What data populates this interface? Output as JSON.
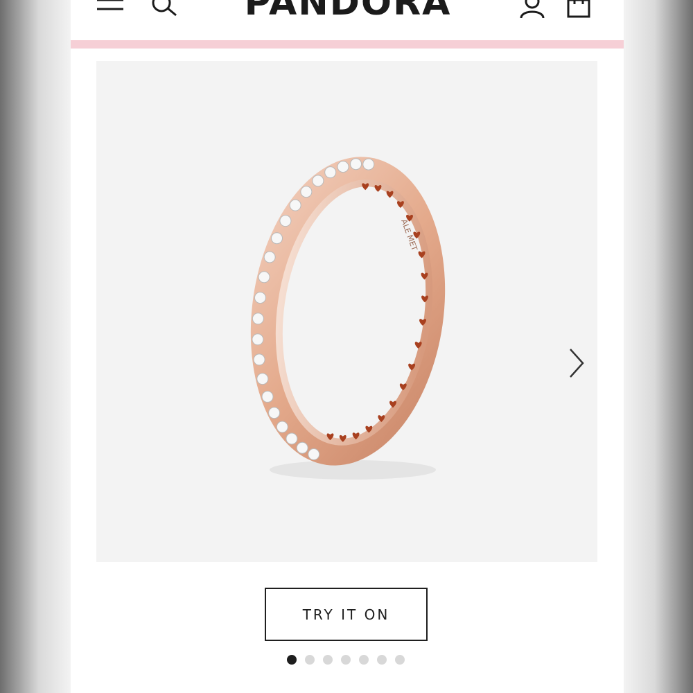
{
  "header": {
    "logo_text": "PANDORA",
    "icons": [
      "menu-icon",
      "search-icon",
      "account-icon",
      "shopping-bag-icon"
    ]
  },
  "product": {
    "image_description_icon": "rose-gold-heart-ring",
    "engraving": "ALE MET",
    "next_icon": "chevron-right-icon"
  },
  "cta": {
    "try_label": "TRY IT ON"
  },
  "carousel": {
    "total": 7,
    "active": 1
  },
  "colors": {
    "accent_pink": "#f6cfd6",
    "text_dark": "#1b1b1b",
    "rose_gold": "#e7b69b",
    "heart_red": "#a8401f"
  }
}
